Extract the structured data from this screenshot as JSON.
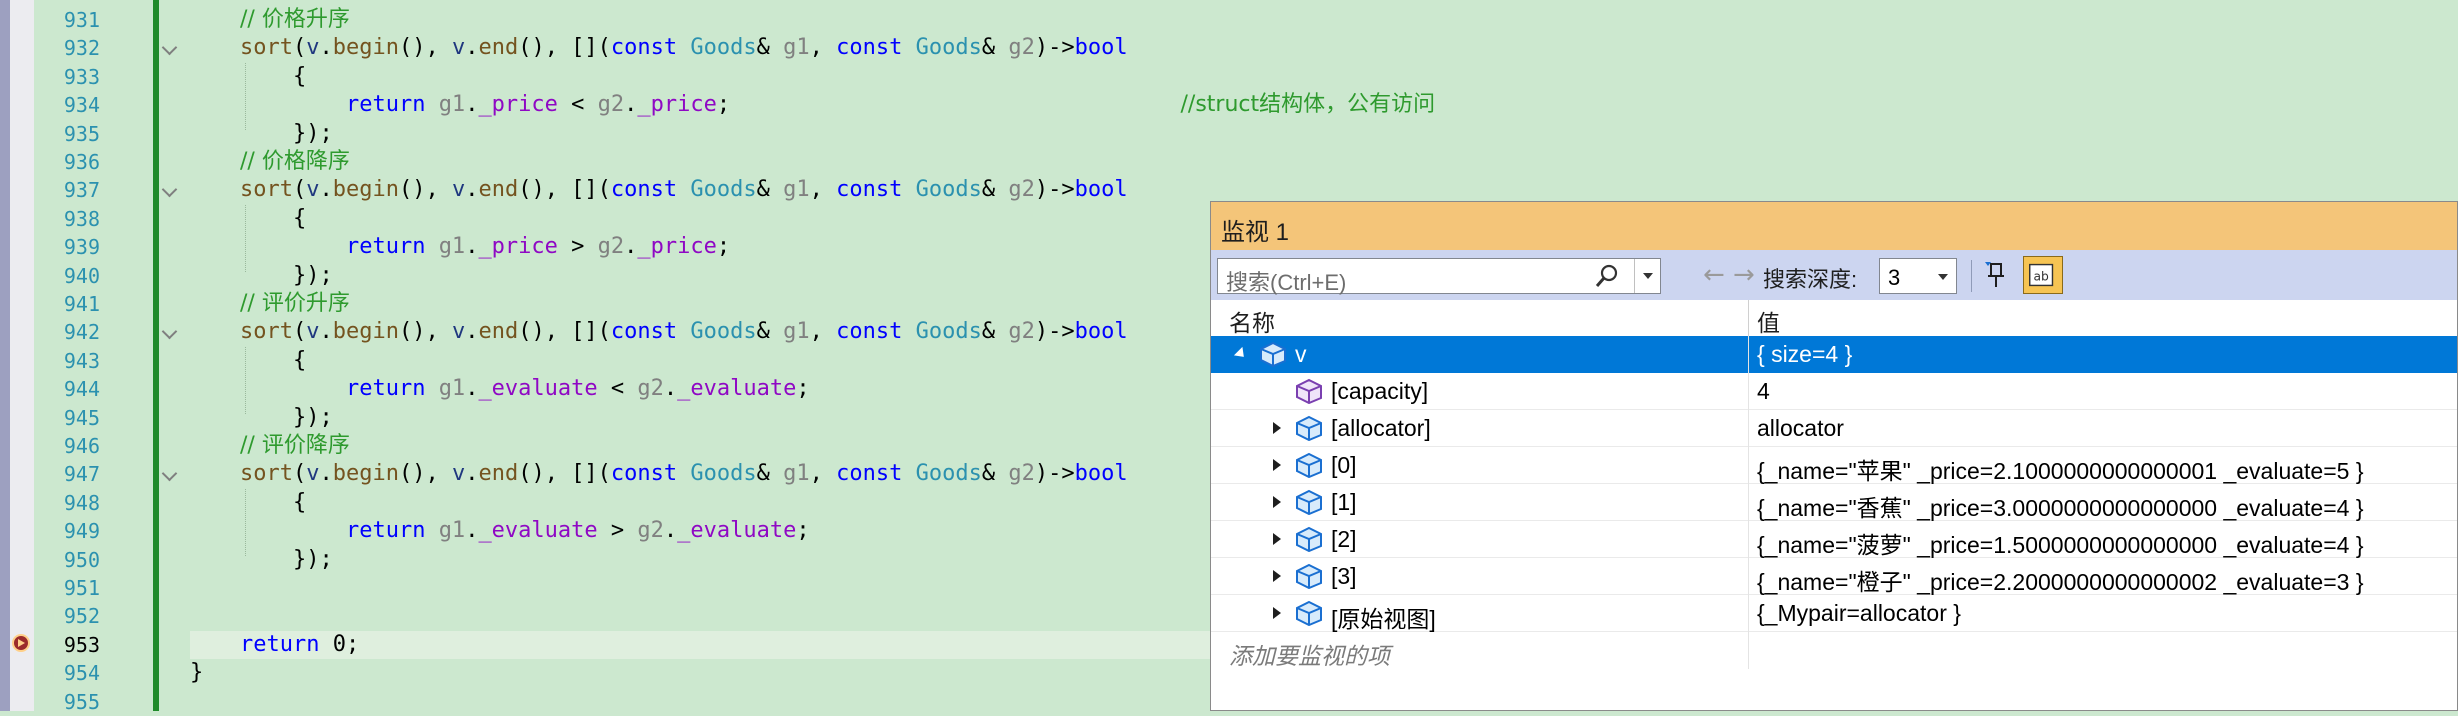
{
  "editor": {
    "lines": [
      {
        "num": "931",
        "tokens": [
          [
            "cm",
            "// 价格升序"
          ]
        ]
      },
      {
        "num": "932",
        "fold": true,
        "tokens": [
          [
            "fn",
            "sort"
          ],
          [
            "pl",
            "("
          ],
          [
            "lv",
            "v"
          ],
          [
            "pl",
            "."
          ],
          [
            "fn",
            "begin"
          ],
          [
            "pl",
            "(), "
          ],
          [
            "lv",
            "v"
          ],
          [
            "pl",
            "."
          ],
          [
            "fn",
            "end"
          ],
          [
            "pl",
            "(), []("
          ],
          [
            "kw",
            "const "
          ],
          [
            "ty",
            "Goods"
          ],
          [
            "pl",
            "& "
          ],
          [
            "pa",
            "g1"
          ],
          [
            "pl",
            ", "
          ],
          [
            "kw",
            "const "
          ],
          [
            "ty",
            "Goods"
          ],
          [
            "pl",
            "& "
          ],
          [
            "pa",
            "g2"
          ],
          [
            "pl",
            ")->"
          ],
          [
            "kw",
            "bool"
          ]
        ]
      },
      {
        "num": "933",
        "tokens": [
          [
            "pl",
            "    {"
          ]
        ]
      },
      {
        "num": "934",
        "tokens": [
          [
            "pl",
            "        "
          ],
          [
            "kw",
            "return "
          ],
          [
            "pa",
            "g1"
          ],
          [
            "pl",
            "."
          ],
          [
            "ct",
            "_price"
          ],
          [
            "pl",
            " < "
          ],
          [
            "pa",
            "g2"
          ],
          [
            "pl",
            "."
          ],
          [
            "ct",
            "_price"
          ],
          [
            "pl",
            ";                                  "
          ],
          [
            "cm",
            "//struct结构体，公有访问"
          ]
        ]
      },
      {
        "num": "935",
        "tokens": [
          [
            "pl",
            "    });"
          ]
        ]
      },
      {
        "num": "936",
        "tokens": [
          [
            "cm",
            "// 价格降序"
          ]
        ]
      },
      {
        "num": "937",
        "fold": true,
        "tokens": [
          [
            "fn",
            "sort"
          ],
          [
            "pl",
            "("
          ],
          [
            "lv",
            "v"
          ],
          [
            "pl",
            "."
          ],
          [
            "fn",
            "begin"
          ],
          [
            "pl",
            "(), "
          ],
          [
            "lv",
            "v"
          ],
          [
            "pl",
            "."
          ],
          [
            "fn",
            "end"
          ],
          [
            "pl",
            "(), []("
          ],
          [
            "kw",
            "const "
          ],
          [
            "ty",
            "Goods"
          ],
          [
            "pl",
            "& "
          ],
          [
            "pa",
            "g1"
          ],
          [
            "pl",
            ", "
          ],
          [
            "kw",
            "const "
          ],
          [
            "ty",
            "Goods"
          ],
          [
            "pl",
            "& "
          ],
          [
            "pa",
            "g2"
          ],
          [
            "pl",
            ")->"
          ],
          [
            "kw",
            "bool"
          ]
        ]
      },
      {
        "num": "938",
        "tokens": [
          [
            "pl",
            "    {"
          ]
        ]
      },
      {
        "num": "939",
        "tokens": [
          [
            "pl",
            "        "
          ],
          [
            "kw",
            "return "
          ],
          [
            "pa",
            "g1"
          ],
          [
            "pl",
            "."
          ],
          [
            "ct",
            "_price"
          ],
          [
            "pl",
            " > "
          ],
          [
            "pa",
            "g2"
          ],
          [
            "pl",
            "."
          ],
          [
            "ct",
            "_price"
          ],
          [
            "pl",
            ";"
          ]
        ]
      },
      {
        "num": "940",
        "tokens": [
          [
            "pl",
            "    });"
          ]
        ]
      },
      {
        "num": "941",
        "tokens": [
          [
            "cm",
            "// 评价升序"
          ]
        ]
      },
      {
        "num": "942",
        "fold": true,
        "tokens": [
          [
            "fn",
            "sort"
          ],
          [
            "pl",
            "("
          ],
          [
            "lv",
            "v"
          ],
          [
            "pl",
            "."
          ],
          [
            "fn",
            "begin"
          ],
          [
            "pl",
            "(), "
          ],
          [
            "lv",
            "v"
          ],
          [
            "pl",
            "."
          ],
          [
            "fn",
            "end"
          ],
          [
            "pl",
            "(), []("
          ],
          [
            "kw",
            "const "
          ],
          [
            "ty",
            "Goods"
          ],
          [
            "pl",
            "& "
          ],
          [
            "pa",
            "g1"
          ],
          [
            "pl",
            ", "
          ],
          [
            "kw",
            "const "
          ],
          [
            "ty",
            "Goods"
          ],
          [
            "pl",
            "& "
          ],
          [
            "pa",
            "g2"
          ],
          [
            "pl",
            ")->"
          ],
          [
            "kw",
            "bool"
          ]
        ]
      },
      {
        "num": "943",
        "tokens": [
          [
            "pl",
            "    {"
          ]
        ]
      },
      {
        "num": "944",
        "tokens": [
          [
            "pl",
            "        "
          ],
          [
            "kw",
            "return "
          ],
          [
            "pa",
            "g1"
          ],
          [
            "pl",
            "."
          ],
          [
            "ct",
            "_evaluate"
          ],
          [
            "pl",
            " < "
          ],
          [
            "pa",
            "g2"
          ],
          [
            "pl",
            "."
          ],
          [
            "ct",
            "_evaluate"
          ],
          [
            "pl",
            ";"
          ]
        ]
      },
      {
        "num": "945",
        "tokens": [
          [
            "pl",
            "    });"
          ]
        ]
      },
      {
        "num": "946",
        "tokens": [
          [
            "cm",
            "// 评价降序"
          ]
        ]
      },
      {
        "num": "947",
        "fold": true,
        "tokens": [
          [
            "fn",
            "sort"
          ],
          [
            "pl",
            "("
          ],
          [
            "lv",
            "v"
          ],
          [
            "pl",
            "."
          ],
          [
            "fn",
            "begin"
          ],
          [
            "pl",
            "(), "
          ],
          [
            "lv",
            "v"
          ],
          [
            "pl",
            "."
          ],
          [
            "fn",
            "end"
          ],
          [
            "pl",
            "(), []("
          ],
          [
            "kw",
            "const "
          ],
          [
            "ty",
            "Goods"
          ],
          [
            "pl",
            "& "
          ],
          [
            "pa",
            "g1"
          ],
          [
            "pl",
            ", "
          ],
          [
            "kw",
            "const "
          ],
          [
            "ty",
            "Goods"
          ],
          [
            "pl",
            "& "
          ],
          [
            "pa",
            "g2"
          ],
          [
            "pl",
            ")->"
          ],
          [
            "kw",
            "bool"
          ]
        ]
      },
      {
        "num": "948",
        "tokens": [
          [
            "pl",
            "    {"
          ]
        ]
      },
      {
        "num": "949",
        "tokens": [
          [
            "pl",
            "        "
          ],
          [
            "kw",
            "return "
          ],
          [
            "pa",
            "g1"
          ],
          [
            "pl",
            "."
          ],
          [
            "ct",
            "_evaluate"
          ],
          [
            "pl",
            " > "
          ],
          [
            "pa",
            "g2"
          ],
          [
            "pl",
            "."
          ],
          [
            "ct",
            "_evaluate"
          ],
          [
            "pl",
            ";"
          ]
        ]
      },
      {
        "num": "950",
        "tokens": [
          [
            "pl",
            "    });"
          ]
        ]
      },
      {
        "num": "951",
        "tokens": []
      },
      {
        "num": "952",
        "tokens": []
      },
      {
        "num": "953",
        "current": true,
        "tokens": [
          [
            "kw",
            "return "
          ],
          [
            "pl",
            "0;"
          ]
        ]
      },
      {
        "num": "954",
        "tokens": [
          [
            "pl",
            "}"
          ]
        ],
        "outdent": true
      },
      {
        "num": "955",
        "tokens": []
      }
    ]
  },
  "watch": {
    "title": "监视 1",
    "search_placeholder": "搜索(Ctrl+E)",
    "back_arrow": "←",
    "forward_arrow": "→",
    "depth_label": "搜索深度:",
    "depth_value": "3",
    "col_name": "名称",
    "col_value": "值",
    "rows": [
      {
        "name": "v",
        "value": "{ size=4 }",
        "level": 0,
        "expand": "open",
        "icon": "object",
        "selected": true
      },
      {
        "name": "[capacity]",
        "value": "4",
        "level": 1,
        "expand": "none",
        "icon": "field"
      },
      {
        "name": "[allocator]",
        "value": "allocator",
        "level": 1,
        "expand": "closed",
        "icon": "object"
      },
      {
        "name": "[0]",
        "value": "{_name=\"苹果\" _price=2.1000000000000001 _evaluate=5 }",
        "level": 1,
        "expand": "closed",
        "icon": "object"
      },
      {
        "name": "[1]",
        "value": "{_name=\"香蕉\" _price=3.0000000000000000 _evaluate=4 }",
        "level": 1,
        "expand": "closed",
        "icon": "object"
      },
      {
        "name": "[2]",
        "value": "{_name=\"菠萝\" _price=1.5000000000000000 _evaluate=4 }",
        "level": 1,
        "expand": "closed",
        "icon": "object"
      },
      {
        "name": "[3]",
        "value": "{_name=\"橙子\" _price=2.2000000000000002 _evaluate=3 }",
        "level": 1,
        "expand": "closed",
        "icon": "object"
      },
      {
        "name": "[原始视图]",
        "value": "{_Mypair=allocator }",
        "level": 1,
        "expand": "closed",
        "icon": "object"
      }
    ],
    "add_watch_placeholder": "添加要监视的项"
  }
}
